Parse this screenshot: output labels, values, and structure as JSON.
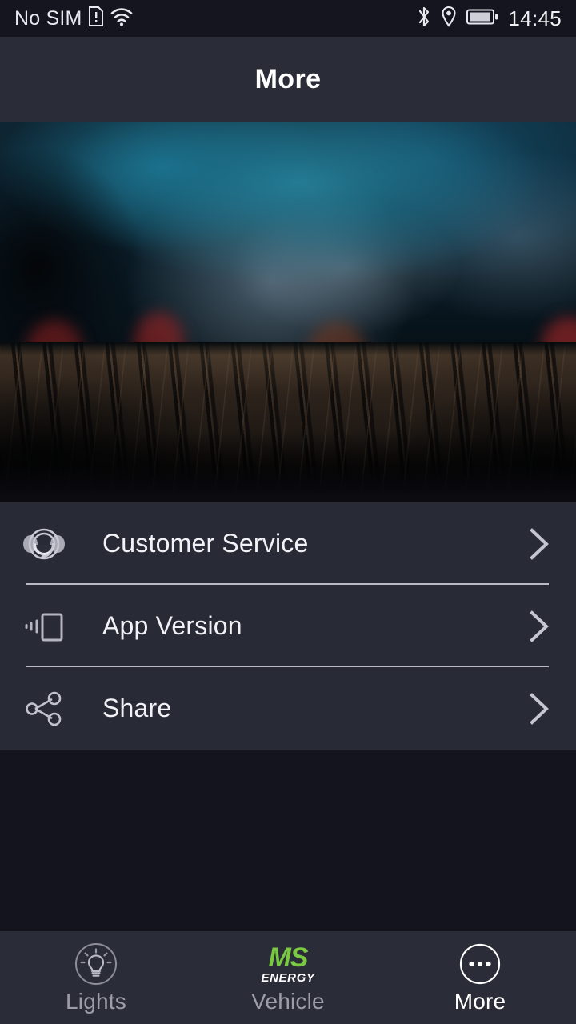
{
  "status_bar": {
    "carrier": "No SIM",
    "time": "14:45",
    "icons": [
      "sim-card-alert-icon",
      "wifi-icon",
      "bluetooth-icon",
      "location-icon",
      "battery-icon"
    ]
  },
  "header": {
    "title": "More"
  },
  "hero": {
    "alt": "blurred night city bokeh lights over dark wooden deck",
    "colors": {
      "sky_teal": "#1c788f",
      "deck_brown": "#3a2d22",
      "bokeh_red": "#b42a2a",
      "bokeh_white": "#cfcfcf",
      "bokeh_amber": "#b08030"
    }
  },
  "menu": {
    "items": [
      {
        "label": "Customer Service",
        "icon": "headset-support-icon",
        "chevron": "chevron-right-icon"
      },
      {
        "label": "App Version",
        "icon": "mobile-device-icon",
        "chevron": "chevron-right-icon"
      },
      {
        "label": "Share",
        "icon": "share-nodes-icon",
        "chevron": "chevron-right-icon"
      }
    ]
  },
  "bottom_nav": {
    "tabs": [
      {
        "label": "Lights",
        "icon": "lightbulb-icon",
        "active": false
      },
      {
        "label": "Vehicle",
        "icon": "ms-energy-logo",
        "active": false
      },
      {
        "label": "More",
        "icon": "ellipsis-circle-icon",
        "active": true
      }
    ],
    "brand": {
      "mark": "MS",
      "sub": "ENERGY",
      "color": "#7ac943"
    }
  },
  "theme": {
    "page_bg": "#14141e",
    "panel_bg": "#282a36",
    "statusbar_bg": "#15151f",
    "text_primary": "#f2f2f6",
    "text_dim": "#9d9daa",
    "divider": "#b9b9c6",
    "accent_green": "#7ac943"
  }
}
